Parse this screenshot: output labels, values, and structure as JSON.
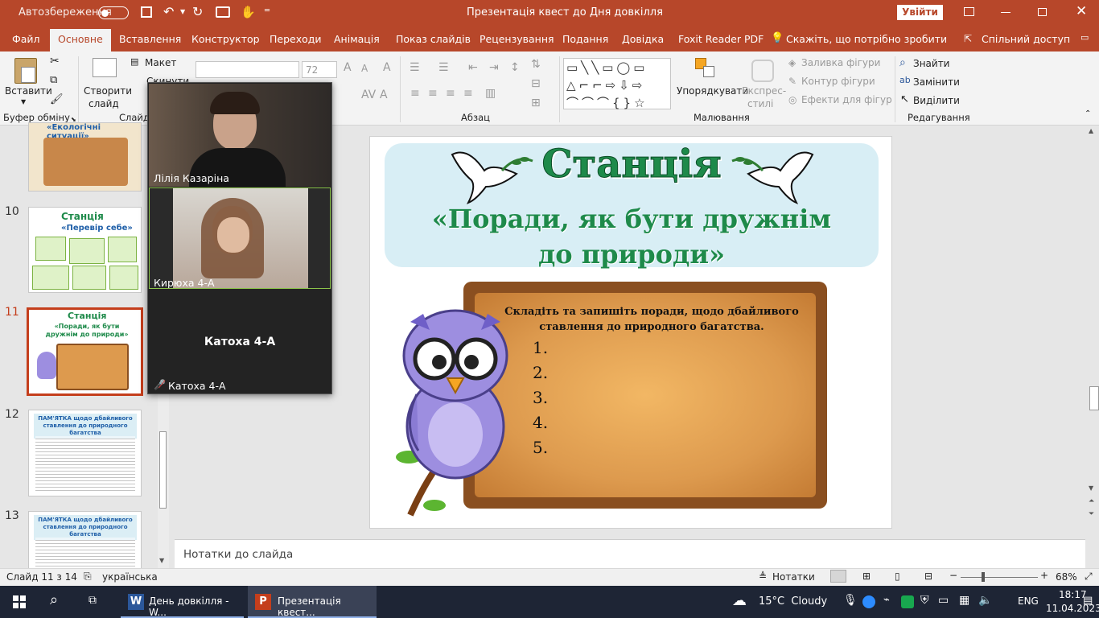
{
  "titlebar": {
    "autosave": "Автозбереження",
    "doc_title": "Презентація квест до Дня довкілля",
    "signin": "Увійти"
  },
  "tabs": [
    "Файл",
    "Основне",
    "Вставлення",
    "Конструктор",
    "Переходи",
    "Анімація",
    "Показ слайдів",
    "Рецензування",
    "Подання",
    "Довідка",
    "Foxit Reader PDF",
    "Скажіть, що потрібно зробити",
    "Спільний доступ"
  ],
  "ribbon": {
    "paste": "Вставити",
    "clipboard": "Буфер обміну",
    "new_slide_1": "Створити",
    "new_slide_2": "слайд",
    "layout": "Макет",
    "reset": "Скинути",
    "slides": "Слайди",
    "font_size": "72",
    "paragraph": "Абзац",
    "arrange": "Упорядкувати",
    "styles_1": "Експрес-",
    "styles_2": "стилі",
    "fill": "Заливка фігури",
    "outline": "Контур фігури",
    "effects": "Ефекти для фігур",
    "drawing": "Малювання",
    "find": "Знайти",
    "replace": "Замінити",
    "select": "Виділити",
    "editing": "Редагування"
  },
  "slides_panel": {
    "numbers": [
      "10",
      "11",
      "12",
      "13"
    ],
    "t9_title": "«Екологічні ситуації»",
    "t10_title": "Станція",
    "t10_sub": "«Перевір себе»",
    "t11_title": "Станція",
    "t11_sub": "«Поради, як бути дружнім до природи»",
    "t12_title": "ПАМ'ЯТКА щодо дбайливого ставлення до природного багатства",
    "t13_title": "ПАМ'ЯТКА щодо дбайливого ставлення до природного багатства"
  },
  "slide": {
    "title": "Станція",
    "subtitle": "«Поради, як бути дружнім до природи»",
    "task": "Складіть та запишіть поради, щодо дбайливого ставлення до природного багатства.",
    "items": [
      "1.",
      "2.",
      "3.",
      "4.",
      "5."
    ]
  },
  "notes": "Нотатки до слайда",
  "status": {
    "slide": "Слайд 11 з 14",
    "lang": "українська",
    "notes_btn": "Нотатки",
    "zoom": "68%"
  },
  "video": {
    "p1": "Лілія Казаріна",
    "p2": "Кирюха 4-А",
    "p3_center": "Катоха 4-А",
    "p3": "Катоха 4-А"
  },
  "taskbar": {
    "app1": "День довкілля - W...",
    "app2": "Презентація квест...",
    "weather": "15°C  Cloudy",
    "lang": "ENG",
    "time": "18:17",
    "date": "11.04.2023"
  },
  "colors": {
    "accent": "#b7472a",
    "station_green": "#1e8a4a",
    "board": "#d89447"
  }
}
